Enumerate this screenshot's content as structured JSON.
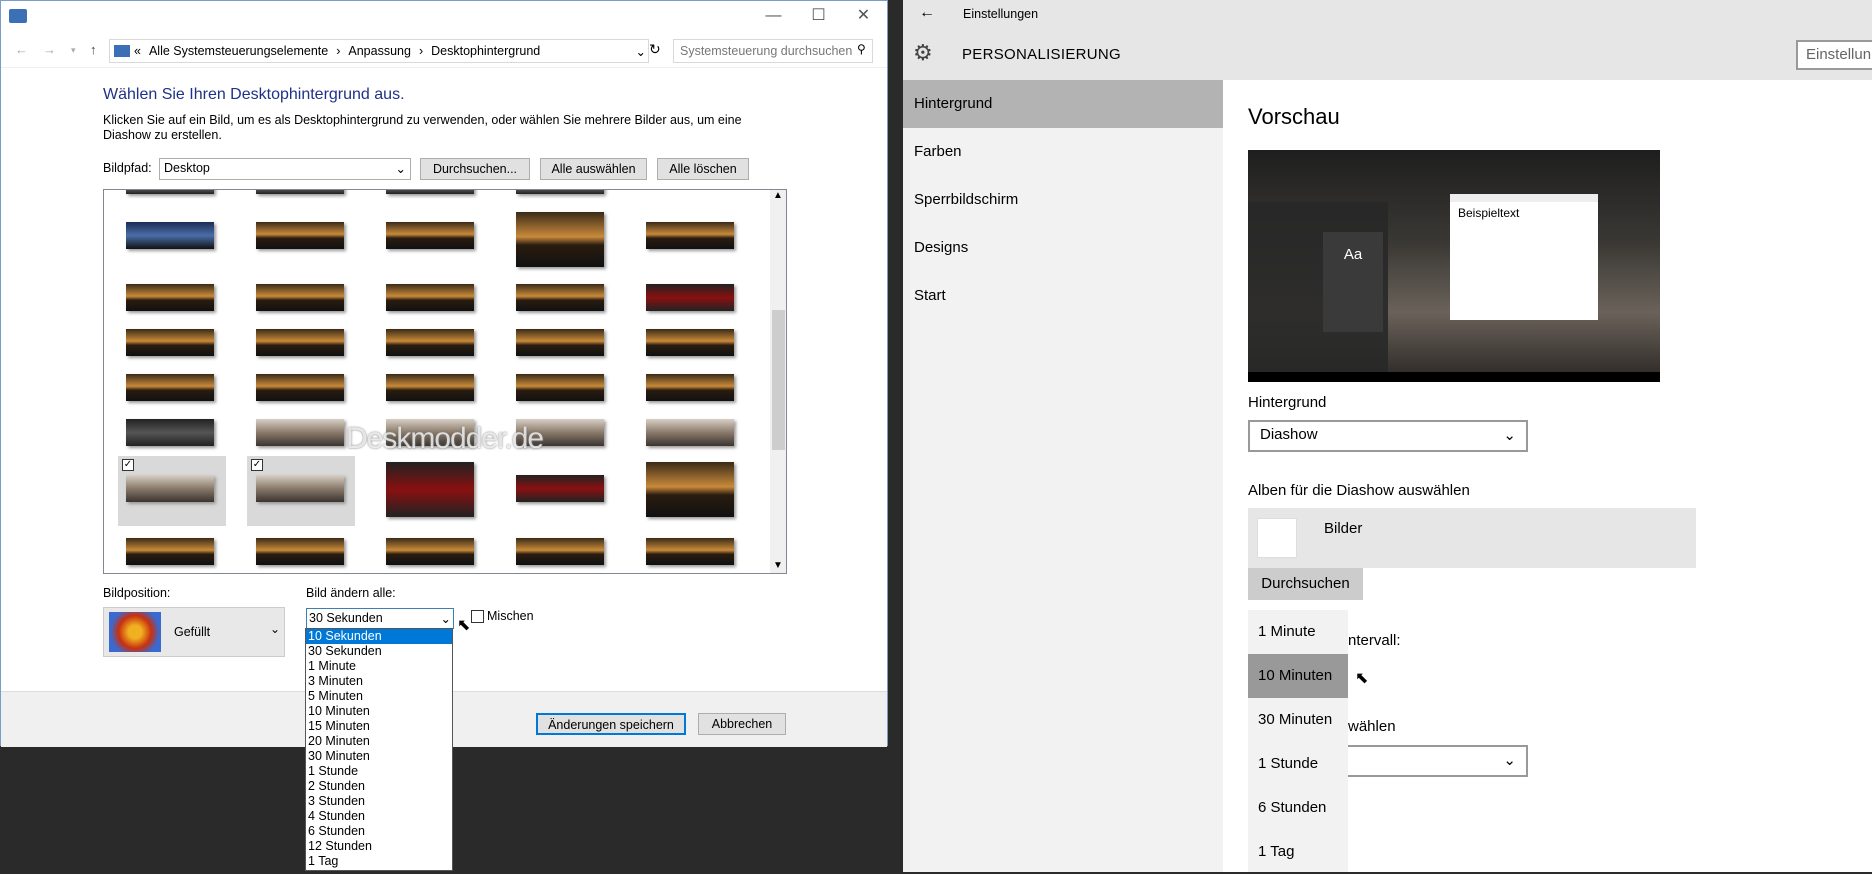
{
  "cp": {
    "address": {
      "sep": "«",
      "crumbs": [
        "Alle Systemsteuerungselemente",
        "Anpassung",
        "Desktophintergrund"
      ],
      "search_placeholder": "Systemsteuerung durchsuchen"
    },
    "title": "Wählen Sie Ihren Desktophintergrund aus.",
    "description": "Klicken Sie auf ein Bild, um es als Desktophintergrund zu verwenden, oder wählen Sie mehrere Bilder aus, um eine Diashow zu erstellen.",
    "path_label": "Bildpfad:",
    "path_value": "Desktop",
    "browse": "Durchsuchen...",
    "select_all": "Alle auswählen",
    "clear_all": "Alle löschen",
    "watermark": "Deskmodder.de",
    "position_label": "Bildposition:",
    "position_value": "Gefüllt",
    "interval_label": "Bild ändern alle:",
    "interval_value": "30 Sekunden",
    "interval_options": [
      "10 Sekunden",
      "30 Sekunden",
      "1 Minute",
      "3 Minuten",
      "5 Minuten",
      "10 Minuten",
      "15 Minuten",
      "20 Minuten",
      "30 Minuten",
      "1 Stunde",
      "2 Stunden",
      "3 Stunden",
      "4 Stunden",
      "6 Stunden",
      "12 Stunden",
      "1 Tag"
    ],
    "shuffle": "Mischen",
    "save": "Änderungen speichern",
    "cancel": "Abbrechen"
  },
  "settings": {
    "window_title": "Einstellungen",
    "section": "PERSONALISIERUNG",
    "search_placeholder": "Einstellun",
    "nav": [
      "Hintergrund",
      "Farben",
      "Sperrbildschirm",
      "Designs",
      "Start"
    ],
    "preview_heading": "Vorschau",
    "preview_sample": "Beispieltext",
    "preview_tile": "Aa",
    "bg_label": "Hintergrund",
    "bg_value": "Diashow",
    "albums_label": "Alben für die Diashow auswählen",
    "album_name": "Bilder",
    "browse": "Durchsuchen",
    "interval_partial": "ntervall:",
    "choose_partial": "wählen",
    "interval_options": [
      "1 Minute",
      "10 Minuten",
      "30 Minuten",
      "1 Stunde",
      "6 Stunden",
      "1 Tag"
    ]
  }
}
